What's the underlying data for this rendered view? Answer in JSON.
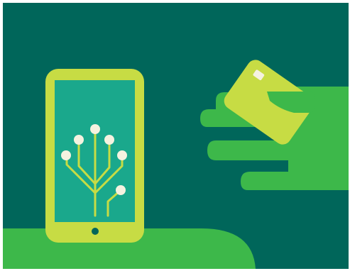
{
  "illustration": {
    "subject": "phone-and-card-payment",
    "icons": [
      "phone-icon",
      "circuit-tree-icon",
      "credit-card-icon",
      "hand-icon"
    ],
    "colors": {
      "background": "#00665a",
      "phone_body": "#c7dc44",
      "phone_screen": "#1aa88c",
      "tree_lines": "#c7dc44",
      "tree_nodes": "#f5f2e0",
      "card": "#c7dc44",
      "card_chip": "#f5f2e0",
      "hand": "#3db84a",
      "ground": "#3db84a",
      "border": "#ffffff"
    }
  }
}
